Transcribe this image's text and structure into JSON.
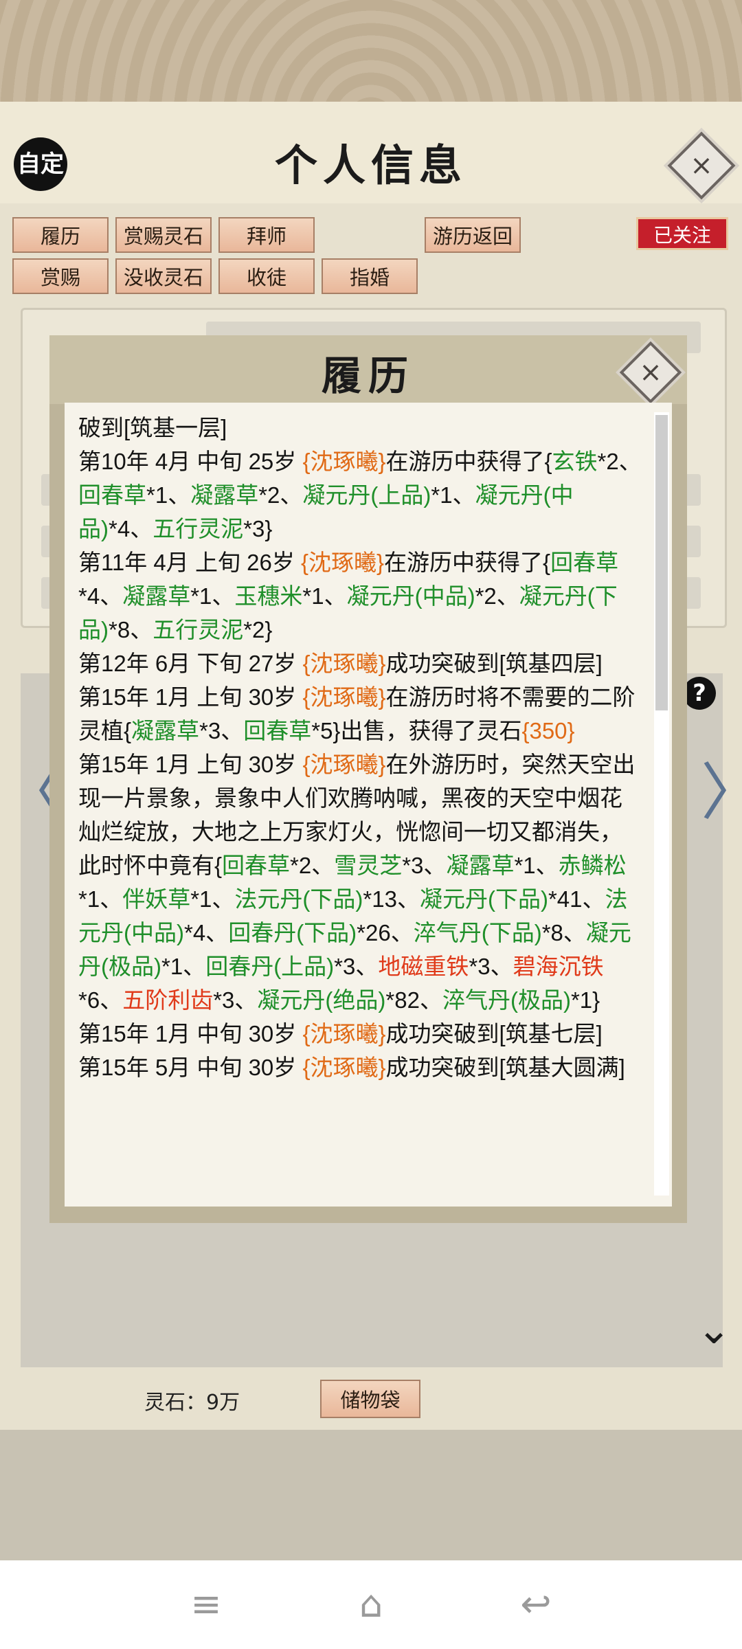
{
  "header": {
    "title": "个人信息",
    "auto_label": "自定",
    "close_icon": "×"
  },
  "actions": {
    "row1": [
      "履历",
      "赏赐灵石",
      "拜师"
    ],
    "travel_return": "游历返回",
    "row2": [
      "赏赐",
      "没收灵石",
      "收徒",
      "指婚"
    ],
    "followed": "已关注"
  },
  "footer": {
    "spirit_stone": "灵石：9万",
    "storage_bag": "储物袋"
  },
  "icons": {
    "help": "?",
    "left_arrow": "〈",
    "right_arrow": "〉",
    "expand": "⌄",
    "nav_menu": "≡",
    "nav_home": "⌂",
    "nav_back": "↩"
  },
  "modal": {
    "title": "履历",
    "close_icon": "×",
    "entries": [
      [
        {
          "t": "破到[筑基一层]"
        }
      ],
      [
        {
          "t": "第10年 4月 中旬  25岁 "
        },
        {
          "t": "{沈琢曦}",
          "c": "o"
        },
        {
          "t": "在游历中获得了{"
        },
        {
          "t": "玄铁",
          "c": "g"
        },
        {
          "t": "*2、"
        },
        {
          "t": "回春草",
          "c": "g"
        },
        {
          "t": "*1、"
        },
        {
          "t": "凝露草",
          "c": "g"
        },
        {
          "t": "*2、"
        },
        {
          "t": "凝元丹(上品)",
          "c": "g"
        },
        {
          "t": "*1、"
        },
        {
          "t": "凝元丹(中品)",
          "c": "g"
        },
        {
          "t": "*4、"
        },
        {
          "t": "五行灵泥",
          "c": "g"
        },
        {
          "t": "*3}"
        }
      ],
      [
        {
          "t": "第11年 4月 上旬  26岁 "
        },
        {
          "t": "{沈琢曦}",
          "c": "o"
        },
        {
          "t": "在游历中获得了{"
        },
        {
          "t": "回春草",
          "c": "g"
        },
        {
          "t": "*4、"
        },
        {
          "t": "凝露草",
          "c": "g"
        },
        {
          "t": "*1、"
        },
        {
          "t": "玉穗米",
          "c": "g"
        },
        {
          "t": "*1、"
        },
        {
          "t": "凝元丹(中品)",
          "c": "g"
        },
        {
          "t": "*2、"
        },
        {
          "t": "凝元丹(下品)",
          "c": "g"
        },
        {
          "t": "*8、"
        },
        {
          "t": "五行灵泥",
          "c": "g"
        },
        {
          "t": "*2}"
        }
      ],
      [
        {
          "t": "第12年 6月 下旬  27岁 "
        },
        {
          "t": "{沈琢曦}",
          "c": "o"
        },
        {
          "t": "成功突破到[筑基四层]"
        }
      ],
      [
        {
          "t": "第15年 1月 上旬  30岁 "
        },
        {
          "t": "{沈琢曦}",
          "c": "o"
        },
        {
          "t": "在游历时将不需要的二阶灵植{"
        },
        {
          "t": "凝露草",
          "c": "g"
        },
        {
          "t": "*3、"
        },
        {
          "t": "回春草",
          "c": "g"
        },
        {
          "t": "*5}出售，获得了灵石"
        },
        {
          "t": "{350}",
          "c": "o"
        }
      ],
      [
        {
          "t": "第15年 1月 上旬  30岁 "
        },
        {
          "t": "{沈琢曦}",
          "c": "o"
        },
        {
          "t": "在外游历时，突然天空出现一片景象，景象中人们欢腾呐喊，黑夜的天空中烟花灿烂绽放，大地之上万家灯火，恍惚间一切又都消失，此时怀中竟有{"
        },
        {
          "t": "回春草",
          "c": "g"
        },
        {
          "t": "*2、"
        },
        {
          "t": "雪灵芝",
          "c": "g"
        },
        {
          "t": "*3、"
        },
        {
          "t": "凝露草",
          "c": "g"
        },
        {
          "t": "*1、"
        },
        {
          "t": "赤鳞松",
          "c": "g"
        },
        {
          "t": "*1、"
        },
        {
          "t": "伴妖草",
          "c": "g"
        },
        {
          "t": "*1、"
        },
        {
          "t": "法元丹(下品)",
          "c": "g"
        },
        {
          "t": "*13、"
        },
        {
          "t": "凝元丹(下品)",
          "c": "g"
        },
        {
          "t": "*41、"
        },
        {
          "t": "法元丹(中品)",
          "c": "g"
        },
        {
          "t": "*4、"
        },
        {
          "t": "回春丹(下品)",
          "c": "g"
        },
        {
          "t": "*26、"
        },
        {
          "t": "淬气丹(下品)",
          "c": "g"
        },
        {
          "t": "*8、"
        },
        {
          "t": "凝元丹(极品)",
          "c": "g"
        },
        {
          "t": "*1、"
        },
        {
          "t": "回春丹(上品)",
          "c": "g"
        },
        {
          "t": "*3、"
        },
        {
          "t": "地磁重铁",
          "c": "r"
        },
        {
          "t": "*3、"
        },
        {
          "t": "碧海沉铁",
          "c": "r"
        },
        {
          "t": "*6、"
        },
        {
          "t": "五阶利齿",
          "c": "r"
        },
        {
          "t": "*3、"
        },
        {
          "t": "凝元丹(绝品)",
          "c": "g"
        },
        {
          "t": "*82、"
        },
        {
          "t": "淬气丹(极品)",
          "c": "g"
        },
        {
          "t": "*1}"
        }
      ],
      [
        {
          "t": "第15年 1月 中旬  30岁 "
        },
        {
          "t": "{沈琢曦}",
          "c": "o"
        },
        {
          "t": "成功突破到[筑基七层]"
        }
      ],
      [
        {
          "t": "第15年 5月 中旬  30岁 "
        },
        {
          "t": "{沈琢曦}",
          "c": "o"
        },
        {
          "t": "成功突破到[筑基大圆满]"
        }
      ]
    ]
  }
}
